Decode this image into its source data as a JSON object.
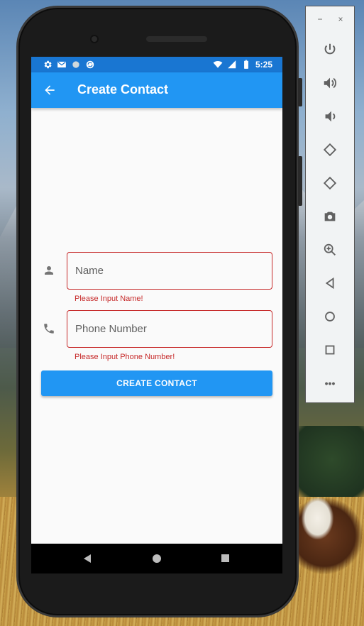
{
  "status_bar": {
    "time": "5:25",
    "icons_left": [
      "settings-icon",
      "gmail-icon",
      "circle-icon",
      "sync-icon"
    ],
    "icons_right": [
      "wifi-icon",
      "signal-icon",
      "battery-icon"
    ]
  },
  "app_bar": {
    "title": "Create Contact",
    "back_icon": "arrow-back-icon"
  },
  "form": {
    "name_field": {
      "placeholder": "Name",
      "value": "",
      "icon": "person-icon",
      "error": "Please Input Name!"
    },
    "phone_field": {
      "placeholder": "Phone Number",
      "value": "",
      "icon": "phone-icon",
      "error": "Please Input Phone Number!"
    },
    "submit_label": "CREATE CONTACT"
  },
  "nav_bar": {
    "buttons": [
      "back",
      "home",
      "recents"
    ]
  },
  "emulator_panel": {
    "window_buttons": [
      "−",
      "×"
    ],
    "tools": [
      "power-icon",
      "volume-up-icon",
      "volume-down-icon",
      "rotate-left-icon",
      "rotate-right-icon",
      "camera-icon",
      "zoom-icon",
      "back-icon",
      "home-icon",
      "overview-icon",
      "more-icon"
    ],
    "more_label": "•••"
  },
  "colors": {
    "primary": "#2196f3",
    "status_bar": "#1976d2",
    "error": "#c62828"
  }
}
